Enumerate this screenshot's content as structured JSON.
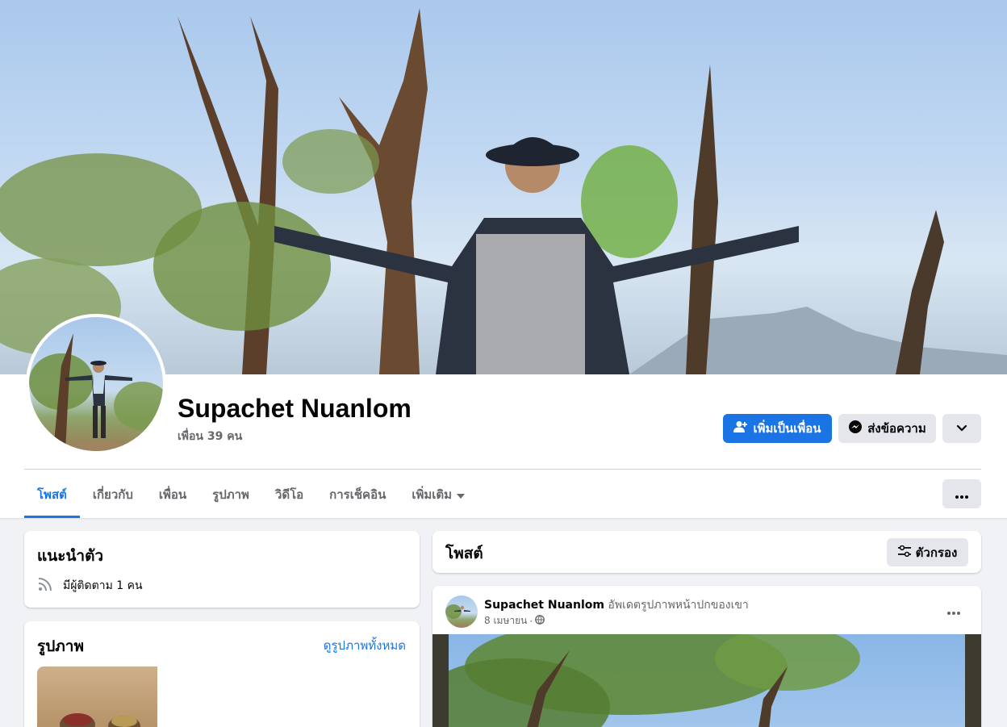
{
  "profile": {
    "name": "Supachet Nuanlom",
    "friends": "เพื่อน 39 คน"
  },
  "actions": {
    "add_friend": "เพิ่มเป็นเพื่อน",
    "message": "ส่งข้อความ"
  },
  "tabs": [
    {
      "label": "โพสต์",
      "active": true
    },
    {
      "label": "เกี่ยวกับ"
    },
    {
      "label": "เพื่อน"
    },
    {
      "label": "รูปภาพ"
    },
    {
      "label": "วิดีโอ"
    },
    {
      "label": "การเช็คอิน"
    },
    {
      "label": "เพิ่มเติม"
    }
  ],
  "intro": {
    "title": "แนะนำตัว",
    "followers": "มีผู้ติดตาม 1 คน"
  },
  "photos": {
    "title": "รูปภาพ",
    "see_all": "ดูรูปภาพทั้งหมด"
  },
  "posts": {
    "title": "โพสต์",
    "filter": "ตัวกรอง"
  },
  "post": {
    "author": "Supachet Nuanlom",
    "action": "อัพเดตรูปภาพหน้าปกของเขา",
    "date": "8 เมษายน",
    "separator": "·"
  },
  "colors": {
    "accent": "#1b74e4",
    "secondary_button": "#e4e6eb",
    "page_background": "#f0f2f5"
  },
  "icons": {
    "add_friend": "user-plus-icon",
    "message": "messenger-icon",
    "dropdown": "chevron-down-icon",
    "more": "ellipsis-icon",
    "followers": "rss-icon",
    "filter": "sliders-icon",
    "audience": "globe-icon"
  }
}
